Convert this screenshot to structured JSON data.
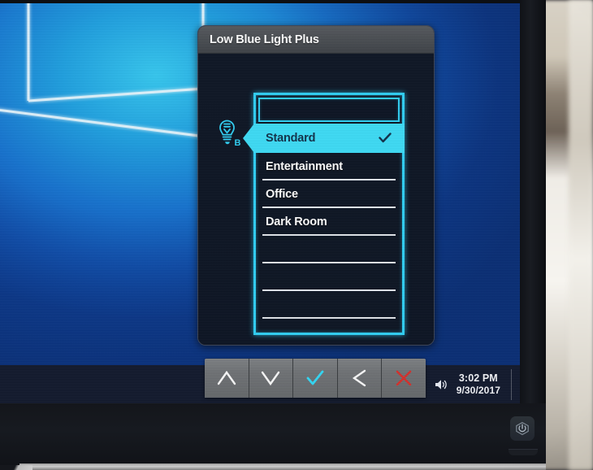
{
  "osd": {
    "title": "Low Blue Light Plus",
    "icon": "low-blue-light-bulb-icon",
    "list": {
      "header_value": "",
      "rows": [
        {
          "label": "Standard",
          "selected": true,
          "check": "✓"
        },
        {
          "label": "Entertainment",
          "selected": false,
          "check": ""
        },
        {
          "label": "Office",
          "selected": false,
          "check": ""
        },
        {
          "label": "Dark Room",
          "selected": false,
          "check": ""
        },
        {
          "label": "",
          "selected": false,
          "check": ""
        },
        {
          "label": "",
          "selected": false,
          "check": ""
        },
        {
          "label": "",
          "selected": false,
          "check": ""
        },
        {
          "label": "",
          "selected": false,
          "check": ""
        }
      ]
    },
    "accent_color": "#2fd0f5",
    "highlight_color": "#3ddcf7",
    "body_color": "#0d1524",
    "titlebar_color": "#4a4e53"
  },
  "button_bar": {
    "buttons": [
      {
        "name": "up-button",
        "icon": "chevron-up-icon",
        "color": "#ffffff"
      },
      {
        "name": "down-button",
        "icon": "chevron-down-icon",
        "color": "#ffffff"
      },
      {
        "name": "confirm-button",
        "icon": "check-icon",
        "color": "#35d3ef"
      },
      {
        "name": "back-button",
        "icon": "chevron-left-icon",
        "color": "#ffffff"
      },
      {
        "name": "exit-button",
        "icon": "close-x-icon",
        "color": "#d0322e"
      }
    ]
  },
  "taskbar": {
    "tray": {
      "wifi_icon": "wifi-icon",
      "volume_icon": "speaker-icon",
      "time": "3:02 PM",
      "date": "9/30/2017"
    }
  },
  "desktop": {
    "wallpaper": "windows-10-hero-logo",
    "wallpaper_color": "#1268c6"
  },
  "monitor": {
    "power_button_icon": "power-icon",
    "bezel_color": "#15171c"
  }
}
